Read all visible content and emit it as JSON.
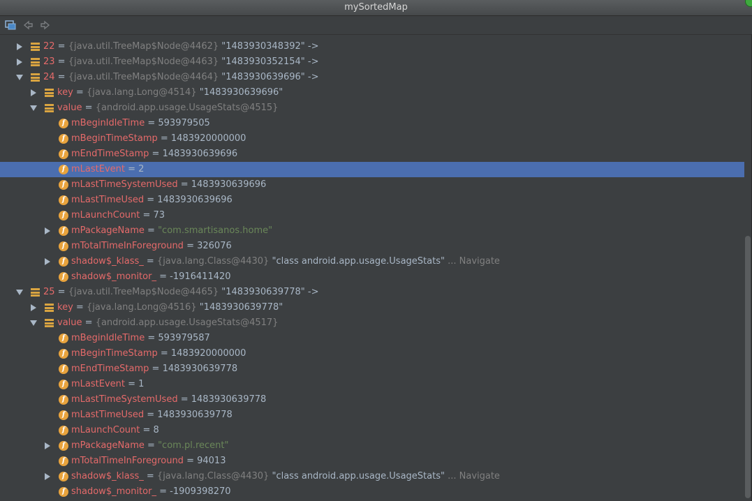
{
  "window": {
    "title": "mySortedMap"
  },
  "icons": {
    "toolbar": [
      "frame-icon",
      "back-icon",
      "forward-icon"
    ],
    "list": "list-icon",
    "field": "field-icon"
  },
  "colors": {
    "background": "#3c3f41",
    "selection": "#4b6eaf",
    "name": "#e56a6a",
    "type": "#808080",
    "string": "#6a8759",
    "value": "#a9b7c6",
    "field_icon": "#e8a33d"
  },
  "tree": {
    "rows": [
      {
        "expand": "right",
        "icon": "list",
        "name": "22",
        "sep": " = ",
        "type": "{java.util.TreeMap$Node@4462}",
        "value": "\"1483930348392\" ->"
      },
      {
        "expand": "right",
        "icon": "list",
        "name": "23",
        "sep": " = ",
        "type": "{java.util.TreeMap$Node@4463}",
        "value": "\"1483930352154\" ->"
      },
      {
        "expand": "down",
        "icon": "list",
        "name": "24",
        "sep": " = ",
        "type": "{java.util.TreeMap$Node@4464}",
        "value": "\"1483930639696\" ->"
      },
      {
        "expand": "right",
        "icon": "list",
        "name": "key",
        "sep": " = ",
        "type": "{java.lang.Long@4514}",
        "value": "\"1483930639696\""
      },
      {
        "expand": "down",
        "icon": "list",
        "name": "value",
        "sep": " = ",
        "type": "{android.app.usage.UsageStats@4515}"
      },
      {
        "icon": "field",
        "name": "mBeginIdleTime",
        "sep": " = ",
        "value": "593979505"
      },
      {
        "icon": "field",
        "name": "mBeginTimeStamp",
        "sep": " = ",
        "value": "1483920000000"
      },
      {
        "icon": "field",
        "name": "mEndTimeStamp",
        "sep": " = ",
        "value": "1483930639696"
      },
      {
        "icon": "field",
        "name": "mLastEvent",
        "sep": " = ",
        "value": "2",
        "selected": true
      },
      {
        "icon": "field",
        "name": "mLastTimeSystemUsed",
        "sep": " = ",
        "value": "1483930639696"
      },
      {
        "icon": "field",
        "name": "mLastTimeUsed",
        "sep": " = ",
        "value": "1483930639696"
      },
      {
        "icon": "field",
        "name": "mLaunchCount",
        "sep": " = ",
        "value": "73"
      },
      {
        "expand": "right",
        "icon": "field",
        "name": "mPackageName",
        "sep": " = ",
        "str": "\"com.smartisanos.home\""
      },
      {
        "icon": "field",
        "name": "mTotalTimeInForeground",
        "sep": " = ",
        "value": "326076"
      },
      {
        "expand": "right",
        "icon": "field",
        "name": "shadow$_klass_",
        "sep": " = ",
        "type": "{java.lang.Class@4430}",
        "value": "\"class android.app.usage.UsageStats\"",
        "nav": "... Navigate"
      },
      {
        "icon": "field",
        "name": "shadow$_monitor_",
        "sep": " = ",
        "value": "-1916411420"
      },
      {
        "expand": "down",
        "icon": "list",
        "name": "25",
        "sep": " = ",
        "type": "{java.util.TreeMap$Node@4465}",
        "value": "\"1483930639778\" ->"
      },
      {
        "expand": "right",
        "icon": "list",
        "name": "key",
        "sep": " = ",
        "type": "{java.lang.Long@4516}",
        "value": "\"1483930639778\""
      },
      {
        "expand": "down",
        "icon": "list",
        "name": "value",
        "sep": " = ",
        "type": "{android.app.usage.UsageStats@4517}"
      },
      {
        "icon": "field",
        "name": "mBeginIdleTime",
        "sep": " = ",
        "value": "593979587"
      },
      {
        "icon": "field",
        "name": "mBeginTimeStamp",
        "sep": " = ",
        "value": "1483920000000"
      },
      {
        "icon": "field",
        "name": "mEndTimeStamp",
        "sep": " = ",
        "value": "1483930639778"
      },
      {
        "icon": "field",
        "name": "mLastEvent",
        "sep": " = ",
        "value": "1"
      },
      {
        "icon": "field",
        "name": "mLastTimeSystemUsed",
        "sep": " = ",
        "value": "1483930639778"
      },
      {
        "icon": "field",
        "name": "mLastTimeUsed",
        "sep": " = ",
        "value": "1483930639778"
      },
      {
        "icon": "field",
        "name": "mLaunchCount",
        "sep": " = ",
        "value": "8"
      },
      {
        "expand": "right",
        "icon": "field",
        "name": "mPackageName",
        "sep": " = ",
        "str": "\"com.pl.recent\""
      },
      {
        "icon": "field",
        "name": "mTotalTimeInForeground",
        "sep": " = ",
        "value": "94013"
      },
      {
        "expand": "right",
        "icon": "field",
        "name": "shadow$_klass_",
        "sep": " = ",
        "type": "{java.lang.Class@4430}",
        "value": "\"class android.app.usage.UsageStats\"",
        "nav": "... Navigate"
      },
      {
        "icon": "field",
        "name": "shadow$_monitor_",
        "sep": " = ",
        "value": "-1909398270"
      }
    ]
  }
}
